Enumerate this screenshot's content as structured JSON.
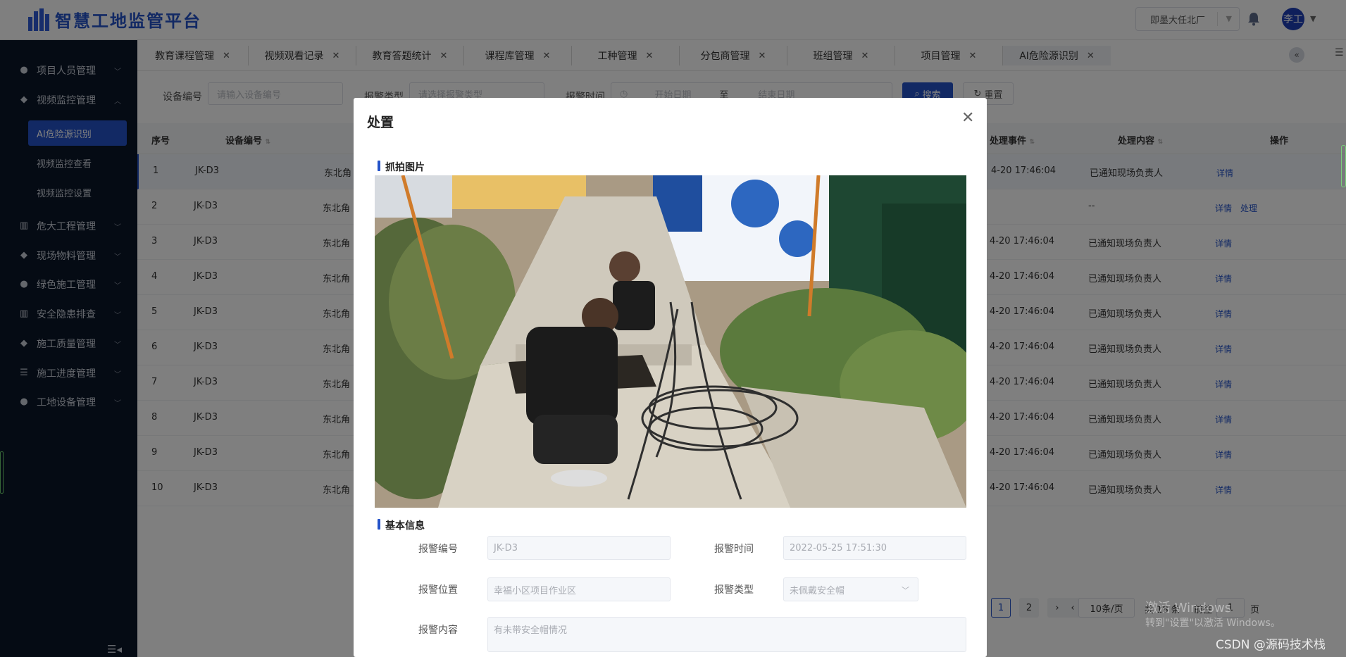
{
  "app": {
    "title": "智慧工地监管平台"
  },
  "header": {
    "project": "即墨大任北厂",
    "user_avatar_text": "李工"
  },
  "sidebar": {
    "items": [
      {
        "label": "项目人员管理",
        "icon": "user-icon"
      },
      {
        "label": "视频监控管理",
        "icon": "video-icon",
        "expanded": true,
        "children": [
          {
            "label": "AI危险源识别",
            "active": true
          },
          {
            "label": "视频监控查看"
          },
          {
            "label": "视频监控设置"
          }
        ]
      },
      {
        "label": "危大工程管理",
        "icon": "building-icon"
      },
      {
        "label": "现场物料管理",
        "icon": "box-icon"
      },
      {
        "label": "绿色施工管理",
        "icon": "user-icon"
      },
      {
        "label": "安全隐患排查",
        "icon": "building-icon"
      },
      {
        "label": "施工质量管理",
        "icon": "box-icon"
      },
      {
        "label": "施工进度管理",
        "icon": "server-icon"
      },
      {
        "label": "工地设备管理",
        "icon": "user-icon"
      }
    ]
  },
  "tabs": [
    {
      "label": "教育课程管理"
    },
    {
      "label": "视频观看记录"
    },
    {
      "label": "教育答题统计"
    },
    {
      "label": "课程库管理"
    },
    {
      "label": "工种管理"
    },
    {
      "label": "分包商管理"
    },
    {
      "label": "班组管理"
    },
    {
      "label": "项目管理"
    },
    {
      "label": "AI危险源识别",
      "active": true
    }
  ],
  "filters": {
    "device_label": "设备编号",
    "device_placeholder": "请输入设备编号",
    "type_label": "报警类型",
    "type_placeholder": "请选择报警类型",
    "time_label": "报警时间",
    "start_placeholder": "开始日期",
    "range_sep": "至",
    "end_placeholder": "结束日期",
    "search_label": "搜索",
    "reset_label": "重置"
  },
  "table": {
    "columns": [
      "序号",
      "设备编号",
      "处理事件",
      "处理内容",
      "操作"
    ],
    "rows": [
      {
        "no": "1",
        "device": "JK-D3",
        "location": "东北角",
        "time": "4-20 17:46:04",
        "content": "已通知现场负责人",
        "actions": [
          "详情"
        ]
      },
      {
        "no": "2",
        "device": "JK-D3",
        "location": "东北角",
        "time": "",
        "content": "--",
        "actions": [
          "详情",
          "处理"
        ]
      },
      {
        "no": "3",
        "device": "JK-D3",
        "location": "东北角",
        "time": "4-20 17:46:04",
        "content": "已通知现场负责人",
        "actions": [
          "详情"
        ]
      },
      {
        "no": "4",
        "device": "JK-D3",
        "location": "东北角",
        "time": "4-20 17:46:04",
        "content": "已通知现场负责人",
        "actions": [
          "详情"
        ]
      },
      {
        "no": "5",
        "device": "JK-D3",
        "location": "东北角",
        "time": "4-20 17:46:04",
        "content": "已通知现场负责人",
        "actions": [
          "详情"
        ]
      },
      {
        "no": "6",
        "device": "JK-D3",
        "location": "东北角",
        "time": "4-20 17:46:04",
        "content": "已通知现场负责人",
        "actions": [
          "详情"
        ]
      },
      {
        "no": "7",
        "device": "JK-D3",
        "location": "东北角",
        "time": "4-20 17:46:04",
        "content": "已通知现场负责人",
        "actions": [
          "详情"
        ]
      },
      {
        "no": "8",
        "device": "JK-D3",
        "location": "东北角",
        "time": "4-20 17:46:04",
        "content": "已通知现场负责人",
        "actions": [
          "详情"
        ]
      },
      {
        "no": "9",
        "device": "JK-D3",
        "location": "东北角",
        "time": "4-20 17:46:04",
        "content": "已通知现场负责人",
        "actions": [
          "详情"
        ]
      },
      {
        "no": "10",
        "device": "JK-D3",
        "location": "东北角",
        "time": "4-20 17:46:04",
        "content": "已通知现场负责人",
        "actions": [
          "详情"
        ]
      }
    ]
  },
  "pagination": {
    "pages": [
      "1",
      "2"
    ],
    "current": "1",
    "next": "›",
    "page_size": "10条/页",
    "total_text": "共 18 条",
    "goto_prefix": "前往",
    "goto_value": "1",
    "goto_suffix": "页"
  },
  "modal": {
    "title": "处置",
    "photo_section": "抓拍图片",
    "info_section": "基本信息",
    "fields": {
      "alarm_no_label": "报警编号",
      "alarm_no_value": "JK-D3",
      "alarm_time_label": "报警时间",
      "alarm_time_value": "2022-05-25 17:51:30",
      "alarm_location_label": "报警位置",
      "alarm_location_value": "幸福小区项目作业区",
      "alarm_type_label": "报警类型",
      "alarm_type_value": "未佩戴安全帽",
      "alarm_content_label": "报警内容",
      "alarm_content_value": "有未带安全帽情况"
    }
  },
  "watermarks": {
    "windows_line1": "激活 Windows",
    "windows_line2": "转到\"设置\"以激活 Windows。",
    "csdn": "CSDN @源码技术栈"
  },
  "colors": {
    "accent": "#2453c9",
    "sidebar_bg": "#0b1629"
  }
}
